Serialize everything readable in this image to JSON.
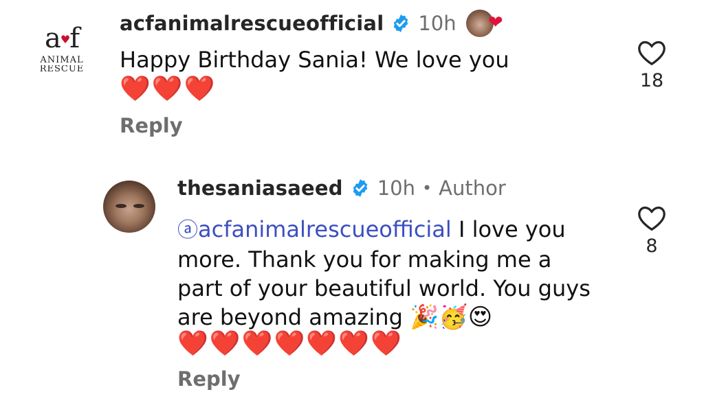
{
  "comments": [
    {
      "username": "acfanimalrescueofficial",
      "time": "10h",
      "avatar_logo": {
        "line1": "acf",
        "line2": "ANIMAL",
        "line3": "RESCUE"
      },
      "text": "Happy Birthday Sania! We love you",
      "hearts": "❤️❤️❤️",
      "reply_label": "Reply",
      "like_count": "18",
      "liked_by_author_icon": "author-avatar-heart"
    },
    {
      "username": "thesaniasaeed",
      "time": "10h",
      "separator": "•",
      "author_label": "Author",
      "mention": "acfanimalrescueofficial",
      "mention_icon": "ⓐ",
      "text": " I love you more. Thank you for making me a part of your beautiful world. You guys are beyond amazing ",
      "emojis": "🎉🥳😍",
      "hearts": "❤️❤️❤️❤️❤️❤️❤️",
      "reply_label": "Reply",
      "like_count": "8"
    }
  ],
  "colors": {
    "verified": "#1d9bf0",
    "heart": "#e0133b",
    "mention": "#3b4fc0",
    "muted": "#6e6e6e"
  }
}
